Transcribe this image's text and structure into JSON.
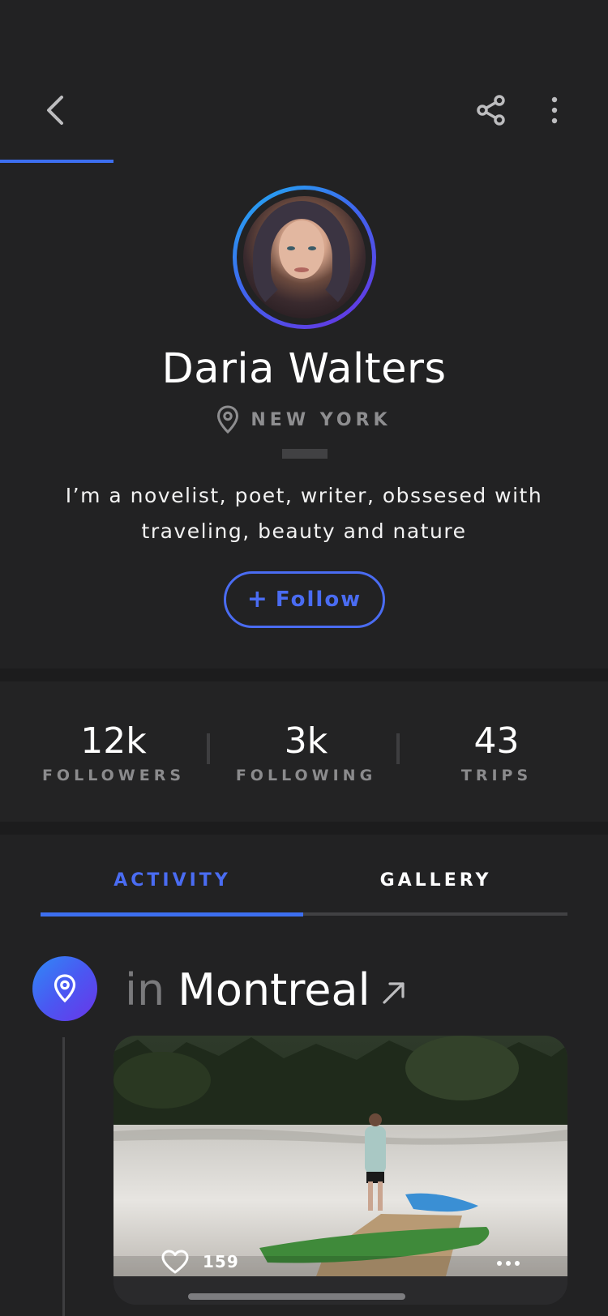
{
  "header": {
    "back_icon": "chevron-left-icon",
    "share_icon": "share-icon",
    "more_icon": "more-vertical-icon"
  },
  "profile": {
    "name": "Daria Walters",
    "location": "NEW YORK",
    "location_icon": "map-pin-icon",
    "bio": "I’m a novelist, poet, writer, obssesed with traveling, beauty and nature",
    "follow_plus": "+",
    "follow_label": "Follow"
  },
  "stats": [
    {
      "value": "12k",
      "label": "FOLLOWERS"
    },
    {
      "value": "3k",
      "label": "FOLLOWING"
    },
    {
      "value": "43",
      "label": "TRIPS"
    }
  ],
  "tabs": [
    {
      "label": "ACTIVITY",
      "active": true
    },
    {
      "label": "GALLERY",
      "active": false
    }
  ],
  "activity": {
    "prefix": "in",
    "place": "Montreal",
    "likes": "159"
  },
  "colors": {
    "background": "#222223",
    "accent": "#4a6cf2",
    "progress": "#3d6ff0",
    "muted_text": "#8b8b8d"
  }
}
